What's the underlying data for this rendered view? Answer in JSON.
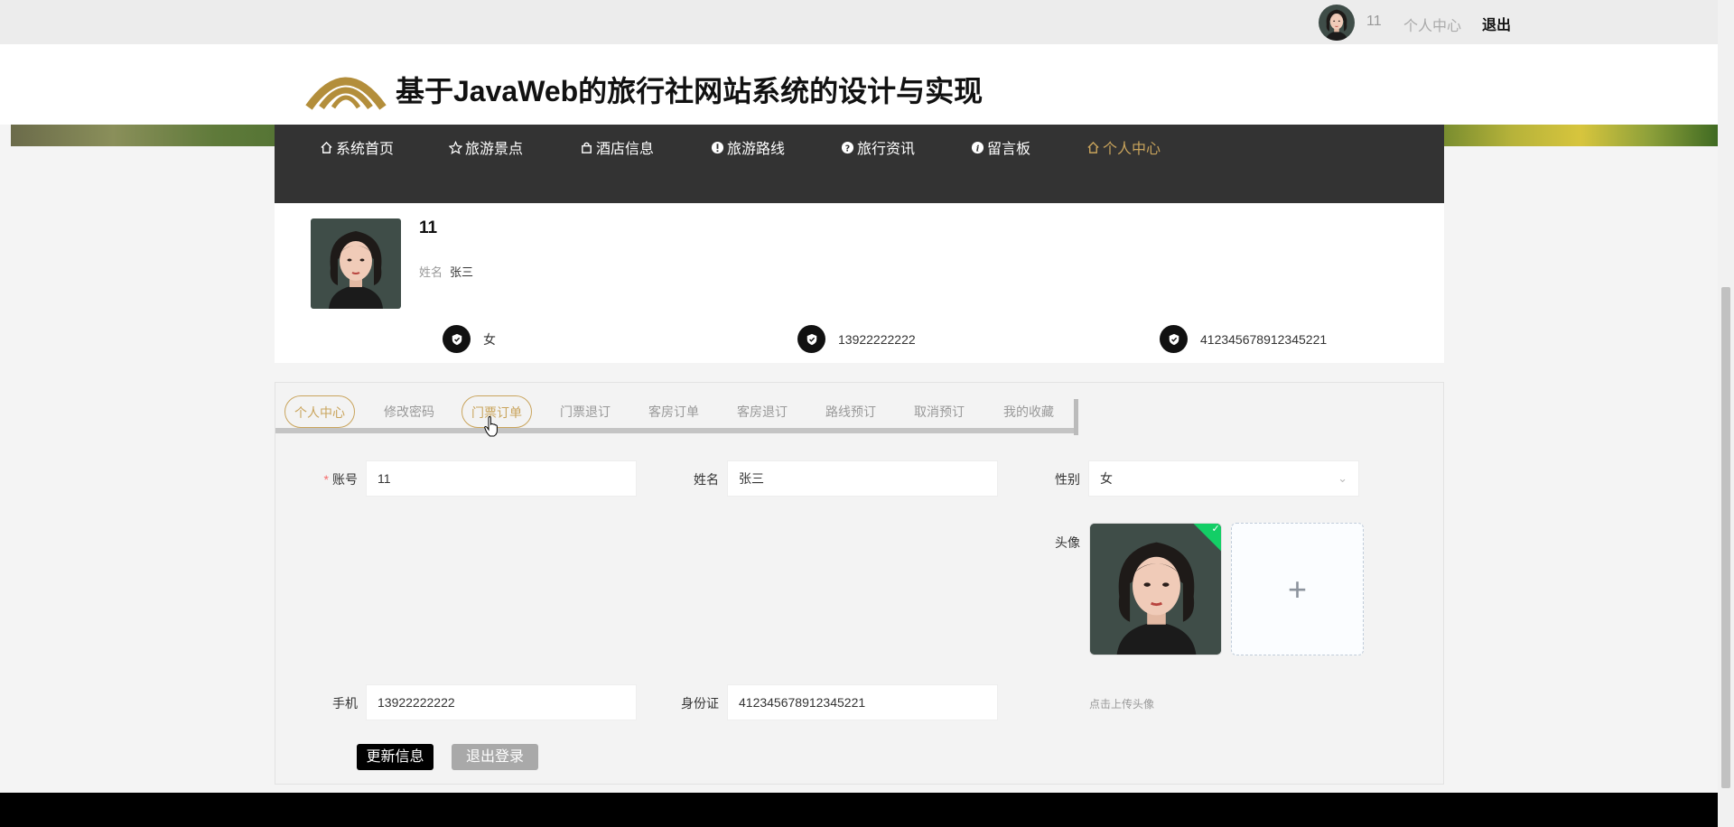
{
  "topbar": {
    "username": "11",
    "center_link": "个人中心",
    "logout_link": "退出"
  },
  "header": {
    "site_title": "基于JavaWeb的旅行社网站系统的设计与实现"
  },
  "nav": {
    "items": [
      {
        "label": "系统首页",
        "icon": "home-icon"
      },
      {
        "label": "旅游景点",
        "icon": "star-icon"
      },
      {
        "label": "酒店信息",
        "icon": "bag-icon"
      },
      {
        "label": "旅游路线",
        "icon": "info-circle-icon"
      },
      {
        "label": "旅行资讯",
        "icon": "question-circle-icon"
      },
      {
        "label": "留言板",
        "icon": "info-italic-icon"
      },
      {
        "label": "个人中心",
        "icon": "home-icon"
      }
    ],
    "active_index": 6
  },
  "profile": {
    "account": "11",
    "name_label": "姓名",
    "name_value": "张三",
    "gender": "女",
    "phone": "13922222222",
    "id_card": "412345678912345221"
  },
  "tabs": [
    {
      "label": "个人中心"
    },
    {
      "label": "修改密码"
    },
    {
      "label": "门票订单"
    },
    {
      "label": "门票退订"
    },
    {
      "label": "客房订单"
    },
    {
      "label": "客房退订"
    },
    {
      "label": "路线预订"
    },
    {
      "label": "取消预订"
    },
    {
      "label": "我的收藏"
    }
  ],
  "form": {
    "account_label": "账号",
    "account_value": "11",
    "name_label": "姓名",
    "name_value": "张三",
    "gender_label": "性别",
    "gender_value": "女",
    "avatar_label": "头像",
    "upload_tip": "点击上传头像",
    "phone_label": "手机",
    "phone_value": "13922222222",
    "idcard_label": "身份证",
    "idcard_value": "412345678912345221",
    "update_button": "更新信息",
    "logout_button": "退出登录"
  },
  "colors": {
    "accent_gold": "#c9a45c",
    "nav_bg": "#333333",
    "success_green": "#13ce66"
  }
}
